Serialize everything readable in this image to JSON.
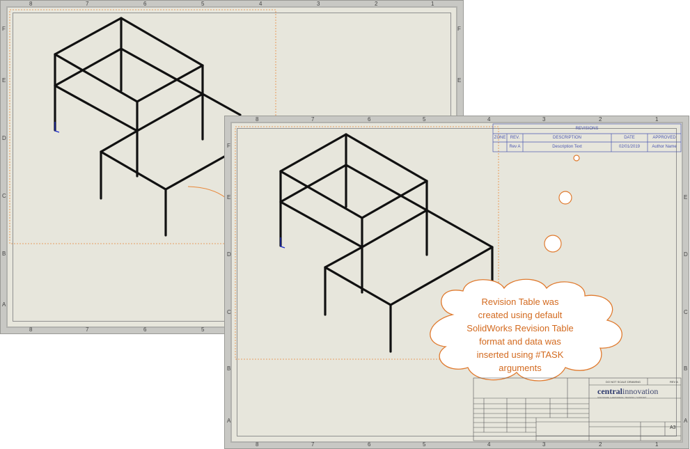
{
  "sheet1": {
    "top_zones": [
      "8",
      "7",
      "6",
      "5",
      "4",
      "3",
      "2",
      "1"
    ],
    "bottom_zones": [
      "8",
      "7",
      "6",
      "5"
    ],
    "side_zones": [
      "F",
      "E",
      "D",
      "C",
      "B",
      "A"
    ]
  },
  "sheet2": {
    "top_zones": [
      "8",
      "7",
      "6",
      "5",
      "4",
      "3",
      "2",
      "1"
    ],
    "bottom_zones": [
      "8",
      "7",
      "6",
      "5",
      "4",
      "3",
      "2",
      "1"
    ],
    "side_zones": [
      "F",
      "E",
      "D",
      "C",
      "B",
      "A"
    ]
  },
  "revision_table": {
    "title": "REVISIONS",
    "headers": [
      "ZONE",
      "REV.",
      "DESCRIPTION",
      "DATE",
      "APPROVED"
    ],
    "row": [
      "",
      "Rev A",
      "Description Text",
      "02/01/2019",
      "Author Name"
    ]
  },
  "callout": {
    "text_lines": [
      "Revision Table was",
      "created using default",
      "SolidWorks Revision Table",
      "format and data was",
      "inserted using #TASK",
      "arguments"
    ],
    "color": "#d36a1f"
  },
  "title_block": {
    "logo_main": "central",
    "logo_rest": "innovation",
    "logo_tagline": "SOFTWARE | HARDWARE | TRAINING | SUPPORT",
    "sheet_size": "A3",
    "rev": "REV A",
    "drawing_label": "DO NOT SCALE DRAWING"
  },
  "colors": {
    "paper": "#e7e6dc",
    "frame": "#c8c8c4",
    "accent_dash": "#e8883a",
    "rev_text": "#4a56b0"
  }
}
